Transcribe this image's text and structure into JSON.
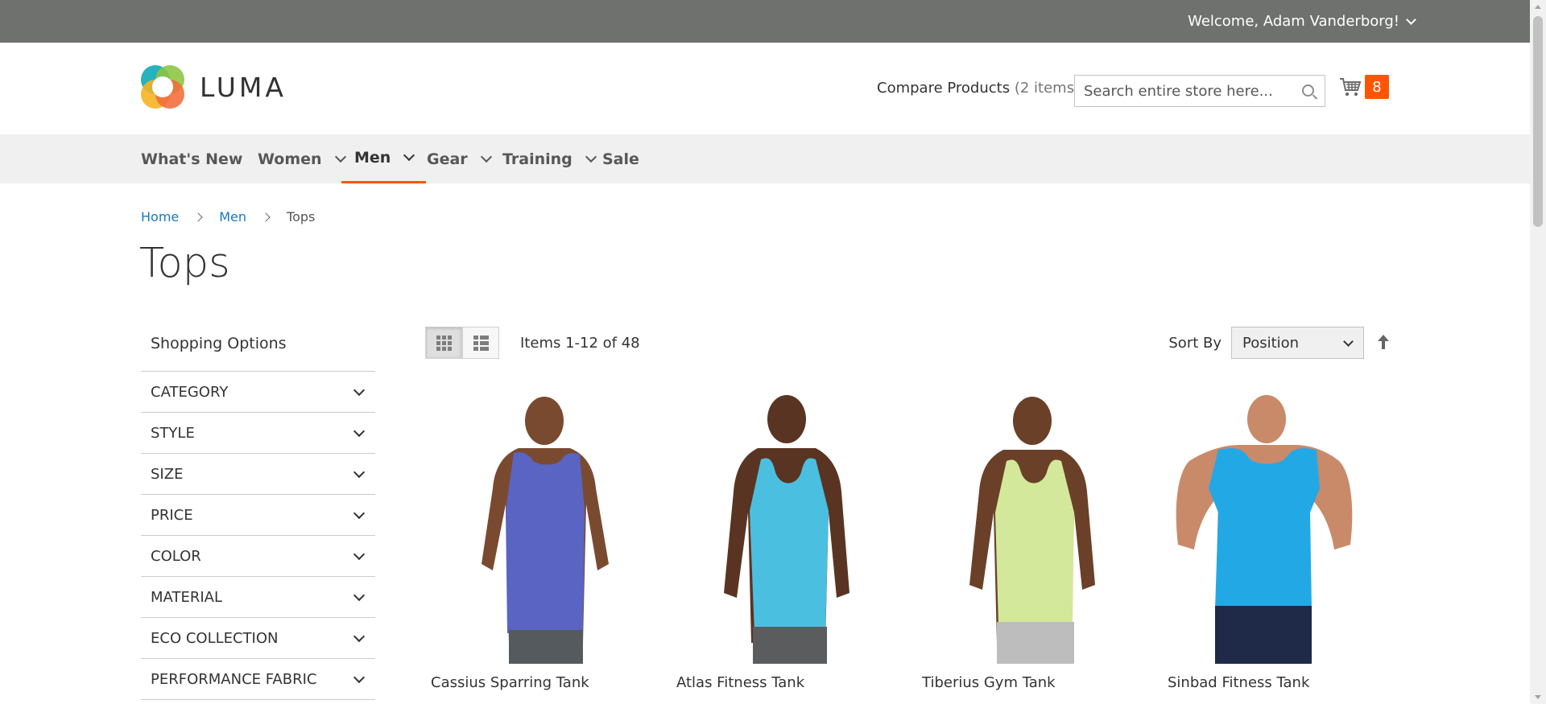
{
  "header": {
    "welcome": "Welcome, Adam Vanderborg!",
    "logo_text": "LUMA",
    "compare_label": "Compare Products",
    "compare_count": "(2 items)",
    "search_placeholder": "Search entire store here...",
    "cart_count": "8"
  },
  "nav": {
    "items": [
      {
        "label": "What's New",
        "dropdown": false
      },
      {
        "label": "Women",
        "dropdown": true
      },
      {
        "label": "Men",
        "dropdown": true,
        "active": true
      },
      {
        "label": "Gear",
        "dropdown": true
      },
      {
        "label": "Training",
        "dropdown": true
      },
      {
        "label": "Sale",
        "dropdown": false
      }
    ]
  },
  "breadcrumbs": {
    "home": "Home",
    "men": "Men",
    "current": "Tops"
  },
  "page": {
    "title": "Tops"
  },
  "sidebar": {
    "title": "Shopping Options",
    "filters": [
      "CATEGORY",
      "STYLE",
      "SIZE",
      "PRICE",
      "COLOR",
      "MATERIAL",
      "ECO COLLECTION",
      "PERFORMANCE FABRIC"
    ]
  },
  "toolbar": {
    "amount": "Items 1-12 of 48",
    "sort_label": "Sort By",
    "sort_value": "Position",
    "view_mode": "grid"
  },
  "products": [
    {
      "name": "Cassius Sparring Tank",
      "shirt_color": "#5a64c2"
    },
    {
      "name": "Atlas Fitness Tank",
      "shirt_color": "#4bbfe0"
    },
    {
      "name": "Tiberius Gym Tank",
      "shirt_color": "#d3e89a"
    },
    {
      "name": "Sinbad Fitness Tank",
      "shirt_color": "#23a8e6"
    }
  ],
  "colors": {
    "topbar": "#6e716e",
    "accent": "#ff5501",
    "link": "#1979c3",
    "nav_bg": "#f0f0f0"
  }
}
